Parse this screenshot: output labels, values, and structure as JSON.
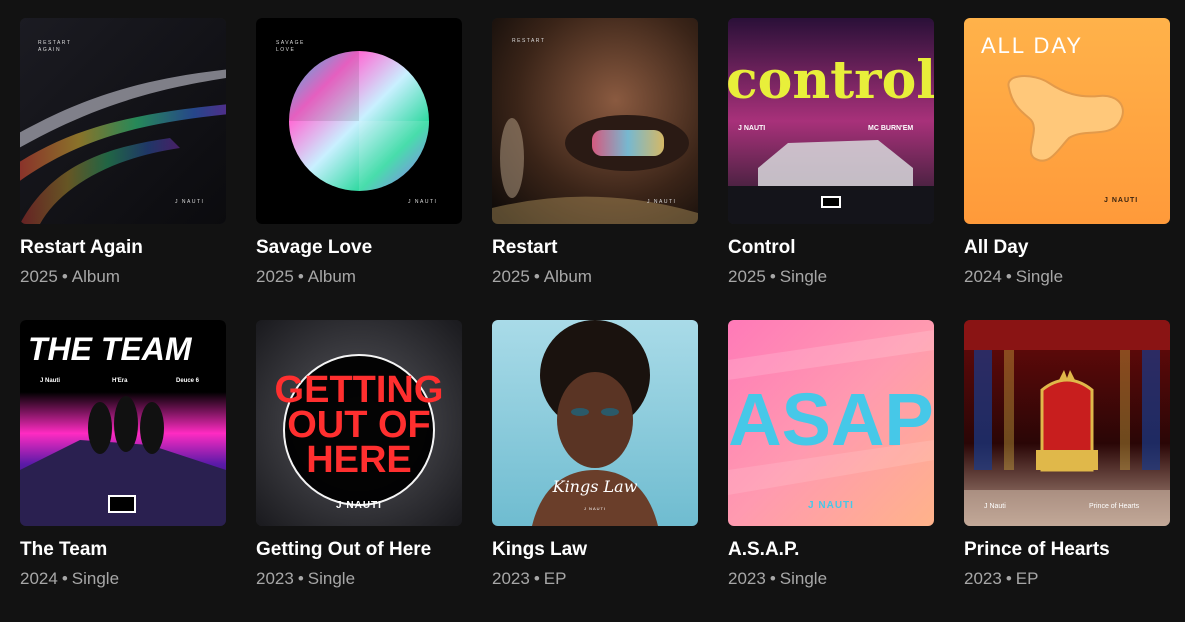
{
  "separator": "•",
  "releases": [
    {
      "title": "Restart Again",
      "year": "2025",
      "type": "Album",
      "cover": {
        "t1": "RESTART",
        "t2": "AGAIN",
        "artist": "J NAUTI"
      }
    },
    {
      "title": "Savage Love",
      "year": "2025",
      "type": "Album",
      "cover": {
        "t1": "SAVAGE",
        "t2": "LOVE",
        "artist": "J NAUTI"
      }
    },
    {
      "title": "Restart",
      "year": "2025",
      "type": "Album",
      "cover": {
        "t1": "RESTART",
        "artist": "J NAUTI"
      }
    },
    {
      "title": "Control",
      "year": "2025",
      "type": "Single",
      "cover": {
        "t1": "control",
        "t2": "J NAUTI",
        "t3": "MC BURN'EM",
        "badge": "PARENTAL ADVISORY"
      }
    },
    {
      "title": "All Day",
      "year": "2024",
      "type": "Single",
      "cover": {
        "t1": "ALL DAY",
        "artist": "J NAUTI"
      }
    },
    {
      "title": "The Team",
      "year": "2024",
      "type": "Single",
      "cover": {
        "t1": "THE TEAM",
        "n1": "J Nauti",
        "n2": "H'Era",
        "n3": "Deuce 6",
        "badge": "PARENTAL ADVISORY"
      }
    },
    {
      "title": "Getting Out of Here",
      "year": "2023",
      "type": "Single",
      "cover": {
        "l1": "GETTING",
        "l2": "OUT OF",
        "l3": "HERE",
        "artist": "J NAUTI"
      }
    },
    {
      "title": "Kings Law",
      "year": "2023",
      "type": "EP",
      "cover": {
        "t1": "Kings Law",
        "artist": "J NAUTI"
      }
    },
    {
      "title": "A.S.A.P.",
      "year": "2023",
      "type": "Single",
      "cover": {
        "t1": "ASAP",
        "artist": "J NAUTI"
      }
    },
    {
      "title": "Prince of Hearts",
      "year": "2023",
      "type": "EP",
      "cover": {
        "t1": "J Nauti",
        "t2": "Prince of Hearts"
      }
    }
  ]
}
